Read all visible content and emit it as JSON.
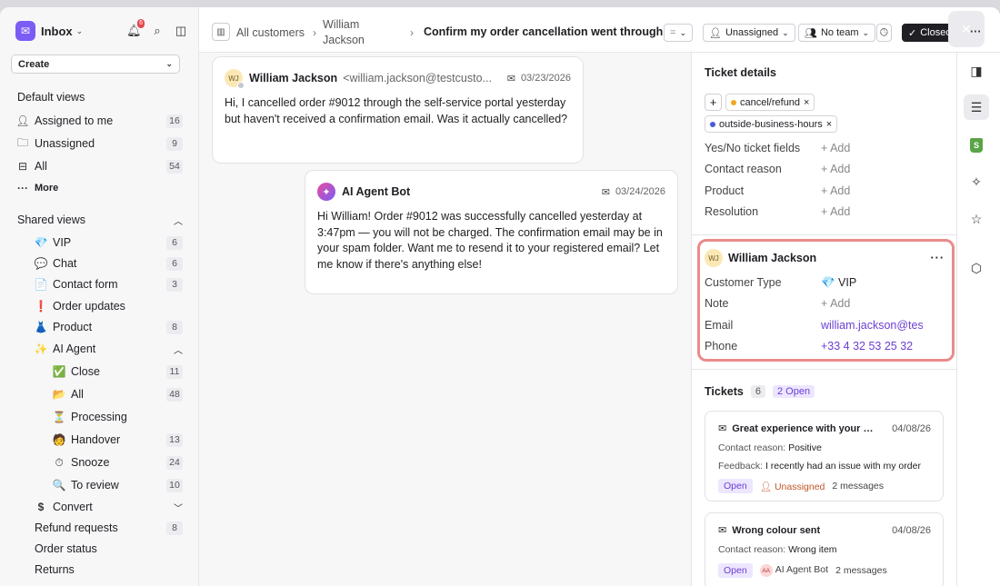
{
  "sidebar": {
    "title": "Inbox",
    "notification_count": "6",
    "create_label": "Create",
    "default_views_title": "Default views",
    "default_views": [
      {
        "label": "Assigned to me",
        "count": "16"
      },
      {
        "label": "Unassigned",
        "count": "9"
      },
      {
        "label": "All",
        "count": "54"
      }
    ],
    "more_label": "More",
    "shared_views_title": "Shared views",
    "shared_views": [
      {
        "icon": "💎",
        "label": "VIP",
        "count": "6"
      },
      {
        "icon": "💬",
        "label": "Chat",
        "count": "6"
      },
      {
        "icon": "📄",
        "label": "Contact form",
        "count": "3"
      },
      {
        "icon": "❗",
        "label": "Order updates",
        "count": ""
      },
      {
        "icon": "👗",
        "label": "Product",
        "count": "8"
      },
      {
        "icon": "✨",
        "label": "AI Agent",
        "count": ""
      }
    ],
    "ai_agent_children": [
      {
        "icon": "✅",
        "label": "Close",
        "count": "11"
      },
      {
        "icon": "📂",
        "label": "All",
        "count": "48"
      },
      {
        "icon": "⏳",
        "label": "Processing",
        "count": ""
      },
      {
        "icon": "🧑",
        "label": "Handover",
        "count": "13"
      },
      {
        "icon": "⏱",
        "label": "Snooze",
        "count": "24"
      },
      {
        "icon": "🔍",
        "label": "To review",
        "count": "10"
      }
    ],
    "bottom_views": [
      {
        "icon": "$",
        "label": "Convert",
        "count": ""
      },
      {
        "label": "Refund requests",
        "count": "8"
      },
      {
        "label": "Order status",
        "count": ""
      },
      {
        "label": "Returns",
        "count": ""
      }
    ]
  },
  "header": {
    "crumb_all": "All customers",
    "crumb_customer_line1": "William",
    "crumb_customer_line2": "Jackson",
    "ticket_title": "Confirm my order cancellation went through",
    "assignee": "Unassigned",
    "team": "No team",
    "status": "Closed"
  },
  "messages": [
    {
      "avatar": "WJ",
      "sender": "William Jackson",
      "email": "<william.jackson@testcusto...",
      "date": "03/23/2026",
      "body": "Hi, I cancelled order #9012 through the self-service portal yesterday but haven't received a confirmation email. Was it actually cancelled?"
    },
    {
      "sender": "AI Agent Bot",
      "date": "03/24/2026",
      "body": "Hi William! Order #9012 was successfully cancelled yesterday at 3:47pm — you will not be charged. The confirmation email may be in your spam folder. Want me to resend it to your registered email? Let me know if there's anything else!"
    }
  ],
  "details": {
    "title": "Ticket details",
    "tags": [
      {
        "label": "cancel/refund",
        "color": "#f5a623"
      },
      {
        "label": "outside-business-hours",
        "color": "#4a5bd4"
      }
    ],
    "fields": [
      {
        "label": "Yes/No ticket fields",
        "value": "+ Add"
      },
      {
        "label": "Contact reason",
        "value": "+ Add"
      },
      {
        "label": "Product",
        "value": "+ Add"
      },
      {
        "label": "Resolution",
        "value": "+ Add"
      }
    ],
    "customer": {
      "initials": "WJ",
      "name": "William Jackson",
      "type_label": "Customer Type",
      "type_value": "💎 VIP",
      "note_label": "Note",
      "note_value": "+ Add",
      "email_label": "Email",
      "email_value": "william.jackson@testcustomer.com",
      "phone_label": "Phone",
      "phone_value": "+33 4 32 53 25 32"
    },
    "tickets_title": "Tickets",
    "tickets_count": "6",
    "tickets_open": "2 Open",
    "tickets": [
      {
        "subject": "Great experience with your su...",
        "date": "04/08/26",
        "line1_label": "Contact reason:",
        "line1_value": "Positive",
        "line2_label": "Feedback:",
        "line2_value": "I recently had an issue with my order",
        "status": "Open",
        "assignee": "Unassigned",
        "messages": "2 messages"
      },
      {
        "subject": "Wrong colour sent",
        "date": "04/08/26",
        "line1_label": "Contact reason:",
        "line1_value": "Wrong item",
        "status": "Open",
        "assignee_initials": "AA",
        "assignee": "AI Agent Bot",
        "messages": "2 messages"
      }
    ]
  },
  "colors": {
    "accent": "#7b5cf5",
    "highlight_border": "#ea8b8b",
    "link": "#6b3fd4"
  }
}
